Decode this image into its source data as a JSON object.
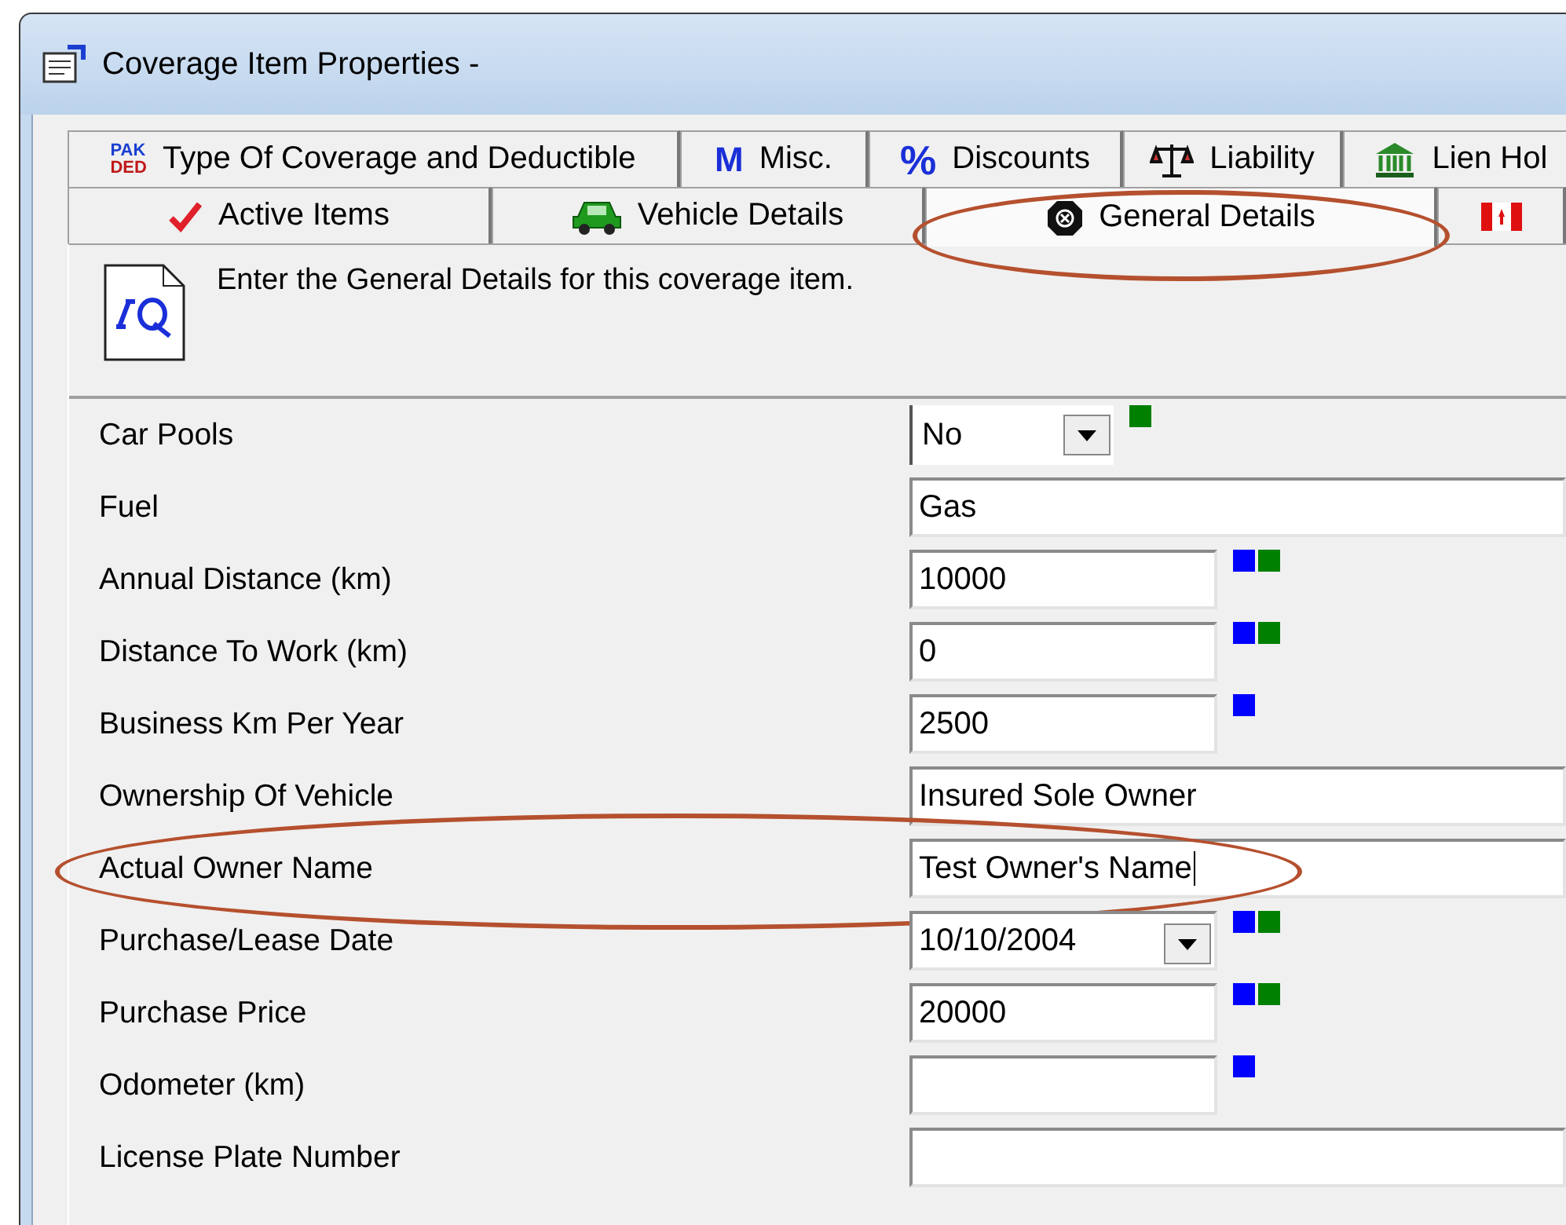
{
  "window": {
    "title": "Coverage Item Properties -"
  },
  "tab_rows": [
    {
      "tabs": [
        {
          "label": "Type Of Coverage and Deductible",
          "icon_text": [
            "PAK",
            "DED"
          ],
          "selected": false
        },
        {
          "label": "Misc.",
          "icon_text": [
            "M"
          ],
          "selected": false
        },
        {
          "label": "Discounts",
          "icon_text": [
            "%"
          ],
          "selected": false
        },
        {
          "label": "Liability",
          "selected": false
        },
        {
          "label": "Lien Hol",
          "selected": false
        }
      ]
    },
    {
      "tabs": [
        {
          "label": "Active Items",
          "selected": false
        },
        {
          "label": "Vehicle Details",
          "selected": false
        },
        {
          "label": "General Details",
          "selected": true
        },
        {
          "selected": false
        }
      ]
    }
  ],
  "intro": "Enter the General Details for this coverage item.",
  "fields": [
    {
      "label": "Car Pools",
      "kind": "dropdown",
      "value": "No",
      "markers": [
        {
          "color": "#008000"
        }
      ]
    },
    {
      "label": "Fuel",
      "kind": "wide",
      "value": "Gas"
    },
    {
      "label": "Annual Distance (km)",
      "kind": "short",
      "value": "10000",
      "markers": [
        {
          "color": "#0000ff"
        },
        {
          "color": "#008000"
        }
      ]
    },
    {
      "label": "Distance To Work (km)",
      "kind": "short",
      "value": "0",
      "markers": [
        {
          "color": "#0000ff"
        },
        {
          "color": "#008000"
        }
      ]
    },
    {
      "label": "Business Km Per Year",
      "kind": "short",
      "value": "2500",
      "markers": [
        {
          "color": "#0000ff"
        }
      ]
    },
    {
      "label": "Ownership Of Vehicle",
      "kind": "wide",
      "value": "Insured Sole Owner"
    },
    {
      "label": "Actual Owner Name",
      "kind": "wide",
      "value": "Test Owner's Name",
      "highlighted": true
    },
    {
      "label": "Purchase/Lease Date",
      "kind": "date",
      "value": "10/10/2004",
      "markers": [
        {
          "color": "#0000ff"
        },
        {
          "color": "#008000"
        }
      ]
    },
    {
      "label": "Purchase Price",
      "kind": "short",
      "value": "20000",
      "markers": [
        {
          "color": "#0000ff"
        },
        {
          "color": "#008000"
        }
      ]
    },
    {
      "label": "Odometer (km)",
      "kind": "short",
      "markers": [
        {
          "color": "#0000ff"
        }
      ]
    },
    {
      "label": "License Plate Number",
      "kind": "wide"
    }
  ]
}
